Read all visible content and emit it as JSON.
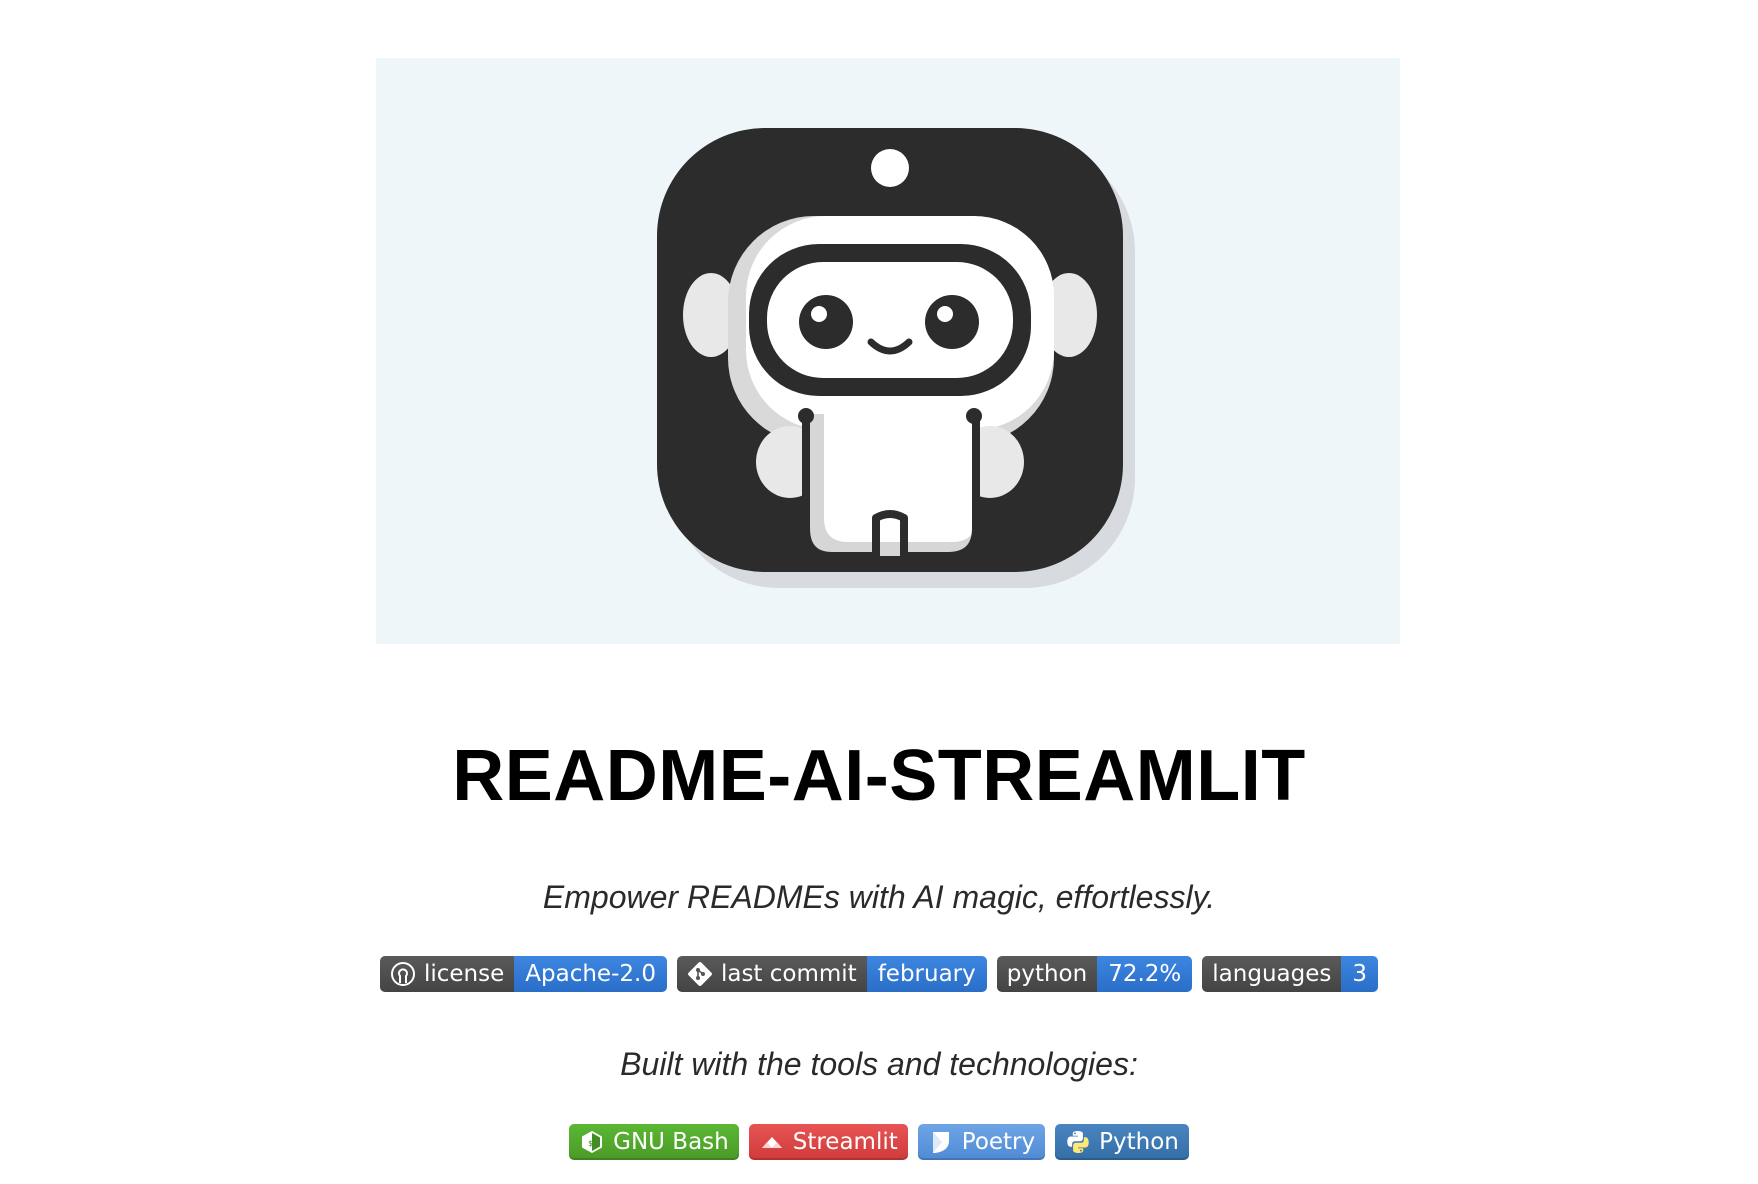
{
  "hero": {
    "logo_icon": "robot-logo"
  },
  "title": "README-AI-STREAMLIT",
  "tagline": "Empower READMEs with AI magic, effortlessly.",
  "badges": [
    {
      "icon": "open-source-icon",
      "label": "license",
      "value": "Apache-2.0"
    },
    {
      "icon": "git-icon",
      "label": "last commit",
      "value": "february"
    },
    {
      "icon": "",
      "label": "python",
      "value": "72.2%"
    },
    {
      "icon": "",
      "label": "languages",
      "value": "3"
    }
  ],
  "built_with": "Built with the tools and technologies:",
  "tech_badges": [
    {
      "icon": "gnu-bash-icon",
      "label": "GNU Bash",
      "color": "#4eaa25"
    },
    {
      "icon": "streamlit-icon",
      "label": "Streamlit",
      "color": "#ff4b4b"
    },
    {
      "icon": "poetry-icon",
      "label": "Poetry",
      "color": "#60a5fa"
    },
    {
      "icon": "python-icon",
      "label": "Python",
      "color": "#3776ab"
    }
  ]
}
